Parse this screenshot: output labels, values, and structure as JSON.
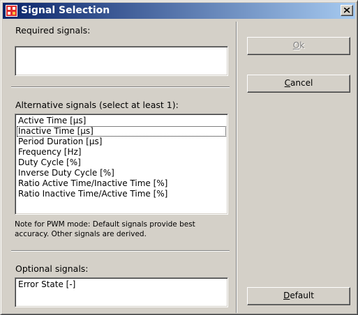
{
  "window": {
    "title": "Signal Selection",
    "icon": "signal-app-icon",
    "close_icon": "close-icon"
  },
  "required": {
    "label": "Required signals:",
    "items": []
  },
  "alternative": {
    "label": "Alternative signals (select at least 1):",
    "items": [
      "Active Time [µs]",
      "Inactive Time [µs]",
      "Period Duration [µs]",
      "Frequency [Hz]",
      "Duty Cycle [%]",
      "Inverse Duty Cycle [%]",
      "Ratio Active Time/Inactive Time [%]",
      "Ratio Inactive Time/Active Time [%]"
    ],
    "focused_item": "Inactive Time [µs]"
  },
  "note": "Note for PWM mode: Default signals provide best accuracy. Other signals are derived.",
  "optional": {
    "label": "Optional signals:",
    "items": [
      "Error State [-]"
    ]
  },
  "buttons": {
    "ok": {
      "mnemonic": "O",
      "rest": "k",
      "enabled": false
    },
    "cancel": {
      "mnemonic": "C",
      "rest": "ancel",
      "enabled": true
    },
    "default": {
      "mnemonic": "D",
      "rest": "efault",
      "enabled": true
    }
  },
  "colors": {
    "face": "#d4d0c8",
    "title_start": "#0a246a",
    "title_end": "#a6caf0",
    "disabled_text": "#808080"
  }
}
